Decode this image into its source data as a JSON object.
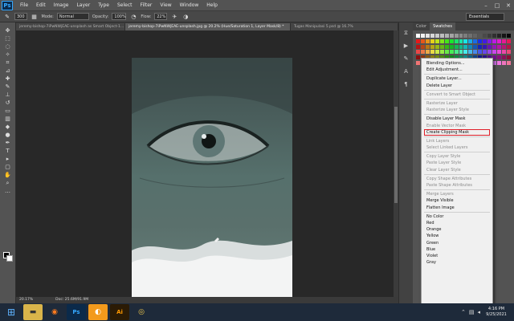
{
  "menubar": {
    "logo": "Ps",
    "items": [
      "File",
      "Edit",
      "Image",
      "Layer",
      "Type",
      "Select",
      "Filter",
      "View",
      "Window",
      "Help"
    ],
    "controls": [
      "–",
      "□",
      "✕"
    ]
  },
  "options": {
    "brush_size": "300",
    "mode_label": "Mode:",
    "mode_value": "Normal",
    "opacity_label": "Opacity:",
    "opacity_value": "100%",
    "flow_label": "Flow:",
    "flow_value": "22%",
    "workspace": "Essentials"
  },
  "tabs": [
    {
      "label": "jeremy-bishop-7iPwNWjEAE-unsplash as Smart Object-1...",
      "active": false
    },
    {
      "label": "jeremy-bishop-7iPwNWjEAE-unsplash.jpg @ 20.2% (Hue/Saturation 1, Layer Mask/8) *",
      "active": true
    },
    {
      "label": "Tugas Manipulasi 5.psd @ 16.7%",
      "active": false
    }
  ],
  "status": {
    "zoom": "20.17%",
    "doc": "Doc: 25.6M/91.9M"
  },
  "panel": {
    "tabs": [
      "Color",
      "Swatches"
    ],
    "active_tab": "Swatches"
  },
  "context_menu": [
    {
      "label": "Blending Options...",
      "disabled": false
    },
    {
      "label": "Edit Adjustment...",
      "disabled": false
    },
    {
      "sep": true
    },
    {
      "label": "Duplicate Layer...",
      "disabled": false
    },
    {
      "label": "Delete Layer",
      "disabled": false
    },
    {
      "sep": true
    },
    {
      "label": "Convert to Smart Object",
      "disabled": true
    },
    {
      "sep": true
    },
    {
      "label": "Rasterize Layer",
      "disabled": true
    },
    {
      "label": "Rasterize Layer Style",
      "disabled": true
    },
    {
      "sep": true
    },
    {
      "label": "Disable Layer Mask",
      "disabled": false
    },
    {
      "label": "Enable Vector Mask",
      "disabled": true
    },
    {
      "label": "Create Clipping Mask",
      "disabled": false,
      "highlight": true
    },
    {
      "sep": true
    },
    {
      "label": "Link Layers",
      "disabled": true
    },
    {
      "label": "Select Linked Layers",
      "disabled": true
    },
    {
      "sep": true
    },
    {
      "label": "Copy Layer Style",
      "disabled": true
    },
    {
      "label": "Paste Layer Style",
      "disabled": true
    },
    {
      "label": "Clear Layer Style",
      "disabled": true
    },
    {
      "sep": true
    },
    {
      "label": "Copy Shape Attributes",
      "disabled": true
    },
    {
      "label": "Paste Shape Attributes",
      "disabled": true
    },
    {
      "sep": true
    },
    {
      "label": "Merge Layers",
      "disabled": true
    },
    {
      "label": "Merge Visible",
      "disabled": false
    },
    {
      "label": "Flatten Image",
      "disabled": false
    },
    {
      "sep": true
    },
    {
      "label": "No Color",
      "disabled": false
    },
    {
      "label": "Red",
      "disabled": false
    },
    {
      "label": "Orange",
      "disabled": false
    },
    {
      "label": "Yellow",
      "disabled": false
    },
    {
      "label": "Green",
      "disabled": false
    },
    {
      "label": "Blue",
      "disabled": false
    },
    {
      "label": "Violet",
      "disabled": false
    },
    {
      "label": "Gray",
      "disabled": false
    }
  ],
  "taskbar": {
    "apps": [
      "windows-start-icon",
      "file-explorer-icon",
      "firefox-icon",
      "photoshop-icon",
      "orange-app-icon",
      "illustrator-icon",
      "chrome-icon"
    ],
    "time": "4:16 PM",
    "date": "9/25/2021"
  },
  "colors": {
    "accent_red": "#e0202a",
    "photoshop_blue": "#35a8ff"
  }
}
